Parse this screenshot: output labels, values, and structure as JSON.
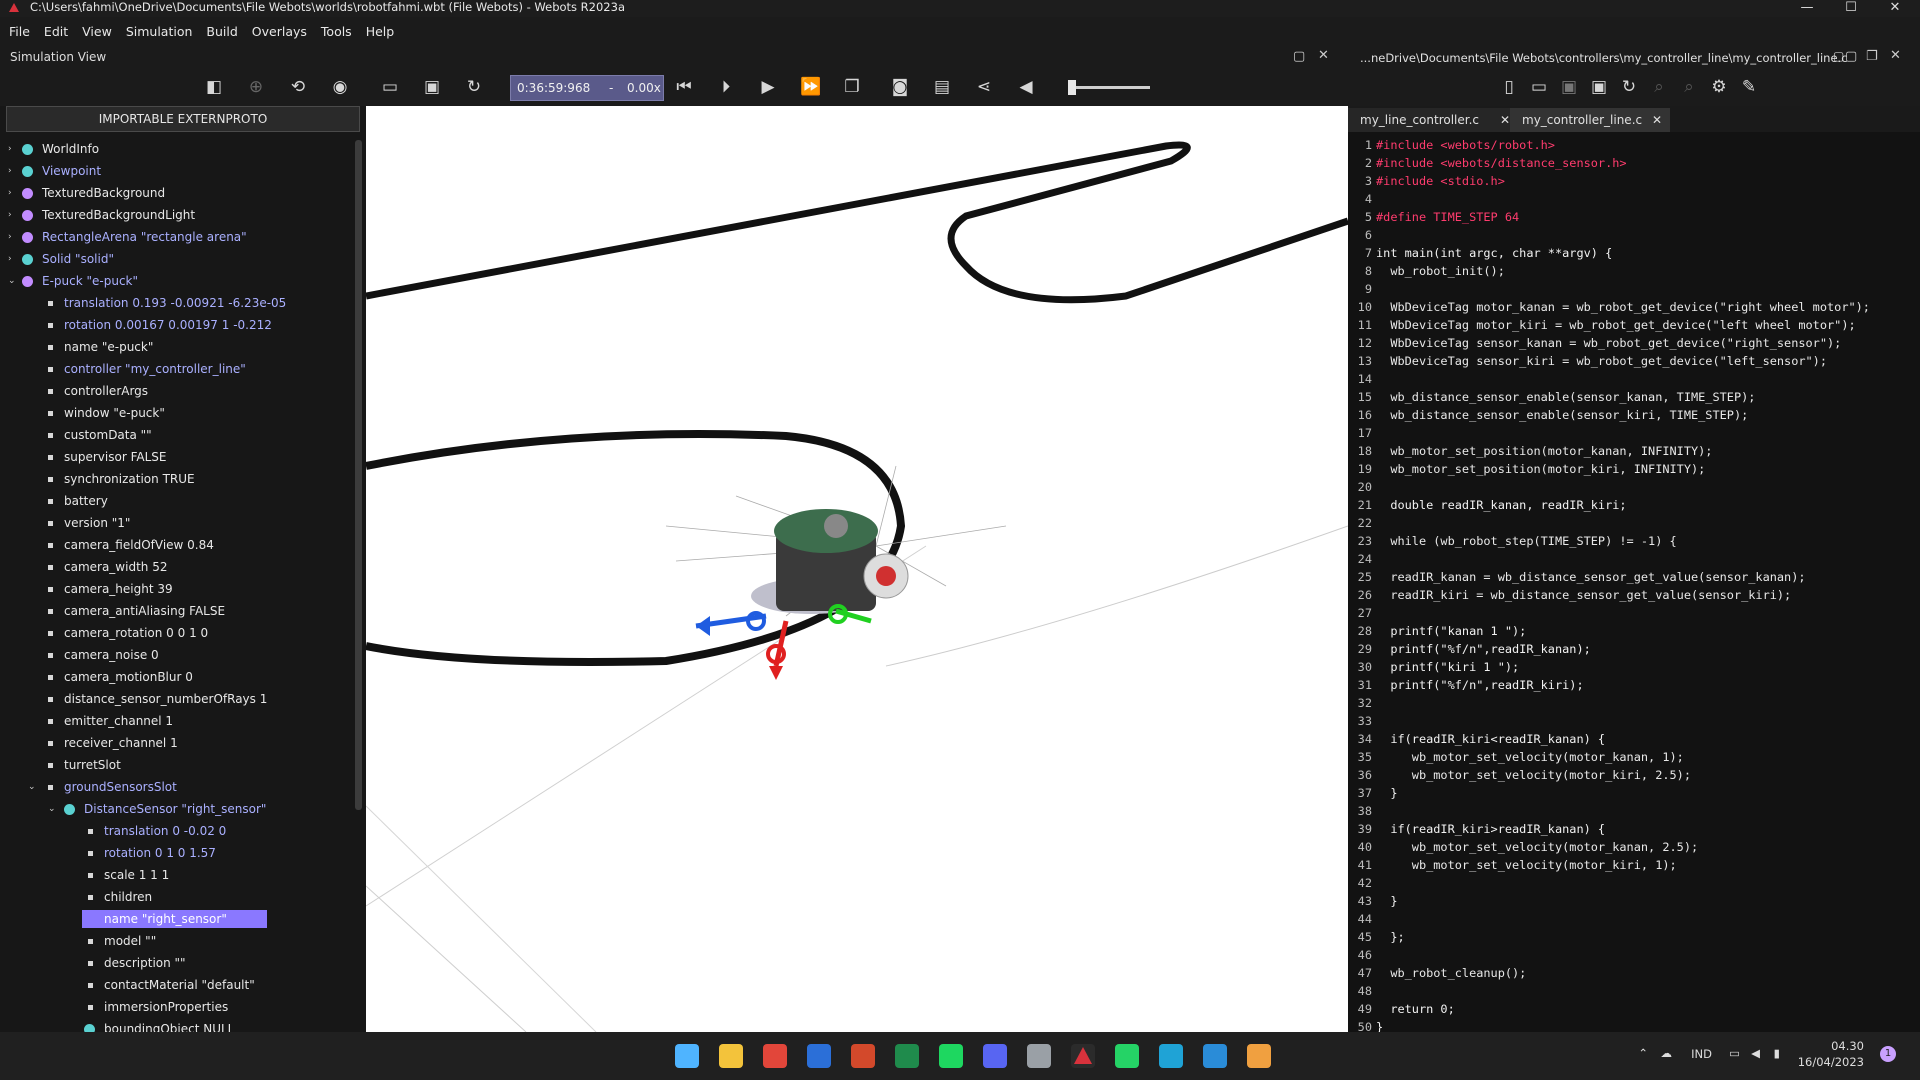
{
  "window": {
    "title": "C:\\Users\\fahmi\\OneDrive\\Documents\\File Webots\\worlds\\robotfahmi.wbt (File Webots) - Webots R2023a",
    "controls": [
      "—",
      "☐",
      "✕"
    ]
  },
  "menu": [
    "File",
    "Edit",
    "View",
    "Simulation",
    "Build",
    "Overlays",
    "Tools",
    "Help"
  ],
  "simulation_view": {
    "label": "Simulation View",
    "time": "0:36:59:968",
    "time_step_sep": "-",
    "speed": "0.00x"
  },
  "scene_tree": {
    "import_button": "IMPORTABLE EXTERNPROTO",
    "items": [
      {
        "text": "WorldInfo",
        "level": 0,
        "arrow": "›",
        "marker": "ball",
        "color": "#5ad1d1",
        "text_color": "#e8e8e8"
      },
      {
        "text": "Viewpoint",
        "level": 0,
        "arrow": "›",
        "marker": "ball",
        "color": "#5ad1d1",
        "text_color": "#aab0ff"
      },
      {
        "text": "TexturedBackground",
        "level": 0,
        "arrow": "›",
        "marker": "ball",
        "color": "#c28cff",
        "text_color": "#e8e8e8"
      },
      {
        "text": "TexturedBackgroundLight",
        "level": 0,
        "arrow": "›",
        "marker": "ball",
        "color": "#c28cff",
        "text_color": "#e8e8e8"
      },
      {
        "text": "RectangleArena \"rectangle arena\"",
        "level": 0,
        "arrow": "›",
        "marker": "ball",
        "color": "#c28cff",
        "text_color": "#aab0ff"
      },
      {
        "text": "Solid \"solid\"",
        "level": 0,
        "arrow": "›",
        "marker": "ball",
        "color": "#5ad1d1",
        "text_color": "#aab0ff"
      },
      {
        "text": "E-puck \"e-puck\"",
        "level": 0,
        "arrow": "⌄",
        "marker": "ball",
        "color": "#c28cff",
        "text_color": "#aab0ff"
      },
      {
        "text": "translation 0.193 -0.00921 -6.23e-05",
        "level": 1,
        "arrow": "",
        "marker": "sq",
        "color": "#d8d8d8",
        "text_color": "#aab0ff"
      },
      {
        "text": "rotation 0.00167 0.00197 1 -0.212",
        "level": 1,
        "arrow": "",
        "marker": "sq",
        "color": "#d8d8d8",
        "text_color": "#aab0ff"
      },
      {
        "text": "name \"e-puck\"",
        "level": 1,
        "arrow": "",
        "marker": "sq",
        "color": "#d8d8d8",
        "text_color": "#e8e8e8"
      },
      {
        "text": "controller \"my_controller_line\"",
        "level": 1,
        "arrow": "",
        "marker": "sq",
        "color": "#d8d8d8",
        "text_color": "#aab0ff"
      },
      {
        "text": "controllerArgs",
        "level": 1,
        "arrow": "",
        "marker": "sq",
        "color": "#d8d8d8",
        "text_color": "#e8e8e8"
      },
      {
        "text": "window \"e-puck\"",
        "level": 1,
        "arrow": "",
        "marker": "sq",
        "color": "#d8d8d8",
        "text_color": "#e8e8e8"
      },
      {
        "text": "customData \"\"",
        "level": 1,
        "arrow": "",
        "marker": "sq",
        "color": "#d8d8d8",
        "text_color": "#e8e8e8"
      },
      {
        "text": "supervisor FALSE",
        "level": 1,
        "arrow": "",
        "marker": "sq",
        "color": "#d8d8d8",
        "text_color": "#e8e8e8"
      },
      {
        "text": "synchronization TRUE",
        "level": 1,
        "arrow": "",
        "marker": "sq",
        "color": "#d8d8d8",
        "text_color": "#e8e8e8"
      },
      {
        "text": "battery",
        "level": 1,
        "arrow": "",
        "marker": "sq",
        "color": "#d8d8d8",
        "text_color": "#e8e8e8"
      },
      {
        "text": "version \"1\"",
        "level": 1,
        "arrow": "",
        "marker": "sq",
        "color": "#d8d8d8",
        "text_color": "#e8e8e8"
      },
      {
        "text": "camera_fieldOfView 0.84",
        "level": 1,
        "arrow": "",
        "marker": "sq",
        "color": "#d8d8d8",
        "text_color": "#e8e8e8"
      },
      {
        "text": "camera_width 52",
        "level": 1,
        "arrow": "",
        "marker": "sq",
        "color": "#d8d8d8",
        "text_color": "#e8e8e8"
      },
      {
        "text": "camera_height 39",
        "level": 1,
        "arrow": "",
        "marker": "sq",
        "color": "#d8d8d8",
        "text_color": "#e8e8e8"
      },
      {
        "text": "camera_antiAliasing FALSE",
        "level": 1,
        "arrow": "",
        "marker": "sq",
        "color": "#d8d8d8",
        "text_color": "#e8e8e8"
      },
      {
        "text": "camera_rotation 0 0 1 0",
        "level": 1,
        "arrow": "",
        "marker": "sq",
        "color": "#d8d8d8",
        "text_color": "#e8e8e8"
      },
      {
        "text": "camera_noise 0",
        "level": 1,
        "arrow": "",
        "marker": "sq",
        "color": "#d8d8d8",
        "text_color": "#e8e8e8"
      },
      {
        "text": "camera_motionBlur 0",
        "level": 1,
        "arrow": "",
        "marker": "sq",
        "color": "#d8d8d8",
        "text_color": "#e8e8e8"
      },
      {
        "text": "distance_sensor_numberOfRays 1",
        "level": 1,
        "arrow": "",
        "marker": "sq",
        "color": "#d8d8d8",
        "text_color": "#e8e8e8"
      },
      {
        "text": "emitter_channel 1",
        "level": 1,
        "arrow": "",
        "marker": "sq",
        "color": "#d8d8d8",
        "text_color": "#e8e8e8"
      },
      {
        "text": "receiver_channel 1",
        "level": 1,
        "arrow": "",
        "marker": "sq",
        "color": "#d8d8d8",
        "text_color": "#e8e8e8"
      },
      {
        "text": "turretSlot",
        "level": 1,
        "arrow": "",
        "marker": "sq",
        "color": "#d8d8d8",
        "text_color": "#e8e8e8"
      },
      {
        "text": "groundSensorsSlot",
        "level": 1,
        "arrow": "⌄",
        "marker": "sq",
        "color": "#d8d8d8",
        "text_color": "#aab0ff"
      },
      {
        "text": "DistanceSensor \"right_sensor\"",
        "level": 2,
        "arrow": "⌄",
        "marker": "ball",
        "color": "#5ad1d1",
        "text_color": "#aab0ff"
      },
      {
        "text": "translation 0 -0.02 0",
        "level": 3,
        "arrow": "",
        "marker": "sq",
        "color": "#d8d8d8",
        "text_color": "#aab0ff"
      },
      {
        "text": "rotation 0 1 0 1.57",
        "level": 3,
        "arrow": "",
        "marker": "sq",
        "color": "#d8d8d8",
        "text_color": "#aab0ff"
      },
      {
        "text": "scale 1 1 1",
        "level": 3,
        "arrow": "",
        "marker": "sq",
        "color": "#d8d8d8",
        "text_color": "#e8e8e8"
      },
      {
        "text": "children",
        "level": 3,
        "arrow": "",
        "marker": "sq",
        "color": "#d8d8d8",
        "text_color": "#e8e8e8"
      },
      {
        "text": "name \"right_sensor\"",
        "level": 3,
        "arrow": "",
        "marker": "sq",
        "color": "#d8d8d8",
        "text_color": "#ffffff",
        "selected": true
      },
      {
        "text": "model \"\"",
        "level": 3,
        "arrow": "",
        "marker": "sq",
        "color": "#d8d8d8",
        "text_color": "#e8e8e8"
      },
      {
        "text": "description \"\"",
        "level": 3,
        "arrow": "",
        "marker": "sq",
        "color": "#d8d8d8",
        "text_color": "#e8e8e8"
      },
      {
        "text": "contactMaterial \"default\"",
        "level": 3,
        "arrow": "",
        "marker": "sq",
        "color": "#d8d8d8",
        "text_color": "#e8e8e8"
      },
      {
        "text": "immersionProperties",
        "level": 3,
        "arrow": "",
        "marker": "sq",
        "color": "#d8d8d8",
        "text_color": "#e8e8e8"
      },
      {
        "text": "boundingObject NULL",
        "level": 3,
        "arrow": "",
        "marker": "ball",
        "color": "#5ad1d1",
        "text_color": "#e8e8e8"
      }
    ]
  },
  "editor": {
    "path": "...neDrive\\Documents\\File Webots\\controllers\\my_controller_line\\my_controller_line.c",
    "tabs": [
      {
        "label": "my_line_controller.c",
        "active": false
      },
      {
        "label": "my_controller_line.c",
        "active": true
      }
    ],
    "tab_close": "✕",
    "lines": [
      "#include <webots/robot.h>",
      "#include <webots/distance_sensor.h>",
      "#include <stdio.h>",
      "",
      "#define TIME_STEP 64",
      "",
      "int main(int argc, char **argv) {",
      "  wb_robot_init();",
      "",
      "  WbDeviceTag motor_kanan = wb_robot_get_device(\"right wheel motor\");",
      "  WbDeviceTag motor_kiri = wb_robot_get_device(\"left wheel motor\");",
      "  WbDeviceTag sensor_kanan = wb_robot_get_device(\"right_sensor\");",
      "  WbDeviceTag sensor_kiri = wb_robot_get_device(\"left_sensor\");",
      "",
      "  wb_distance_sensor_enable(sensor_kanan, TIME_STEP);",
      "  wb_distance_sensor_enable(sensor_kiri, TIME_STEP);",
      "",
      "  wb_motor_set_position(motor_kanan, INFINITY);",
      "  wb_motor_set_position(motor_kiri, INFINITY);",
      "",
      "  double readIR_kanan, readIR_kiri;",
      "",
      "  while (wb_robot_step(TIME_STEP) != -1) {",
      "",
      "  readIR_kanan = wb_distance_sensor_get_value(sensor_kanan);",
      "  readIR_kiri = wb_distance_sensor_get_value(sensor_kiri);",
      "",
      "  printf(\"kanan 1 \");",
      "  printf(\"%f/n\",readIR_kanan);",
      "  printf(\"kiri 1 \");",
      "  printf(\"%f/n\",readIR_kiri);",
      "",
      "",
      "  if(readIR_kiri<readIR_kanan) {",
      "     wb_motor_set_velocity(motor_kanan, 1);",
      "     wb_motor_set_velocity(motor_kiri, 2.5);",
      "  }",
      "",
      "  if(readIR_kiri>readIR_kanan) {",
      "     wb_motor_set_velocity(motor_kanan, 2.5);",
      "     wb_motor_set_velocity(motor_kiri, 1);",
      "",
      "  }",
      "",
      "  };",
      "",
      "  wb_robot_cleanup();",
      "",
      "  return 0;",
      "}"
    ]
  },
  "taskbar": {
    "icons": [
      {
        "name": "windows-start-icon",
        "color": "#4fb4ff"
      },
      {
        "name": "file-explorer-icon",
        "color": "#f3c33b"
      },
      {
        "name": "chrome-icon",
        "color": "#e2463a"
      },
      {
        "name": "word-icon",
        "color": "#2b6fd8"
      },
      {
        "name": "powerpoint-icon",
        "color": "#d3492b"
      },
      {
        "name": "excel-icon",
        "color": "#1f8b4c"
      },
      {
        "name": "spotify-icon",
        "color": "#1ed760"
      },
      {
        "name": "discord-icon",
        "color": "#5865f2"
      },
      {
        "name": "settings-icon",
        "color": "#9aa0a6"
      },
      {
        "name": "webots-icon",
        "color": "#d8323c"
      },
      {
        "name": "whatsapp-icon",
        "color": "#25d366"
      },
      {
        "name": "edge-icon",
        "color": "#1fa3d6"
      },
      {
        "name": "vscode-icon",
        "color": "#2a8cd8"
      },
      {
        "name": "git-icon",
        "color": "#f0a040"
      }
    ],
    "language": "IND",
    "time": "04.30",
    "date": "16/04/2023",
    "notification_count": "1"
  }
}
